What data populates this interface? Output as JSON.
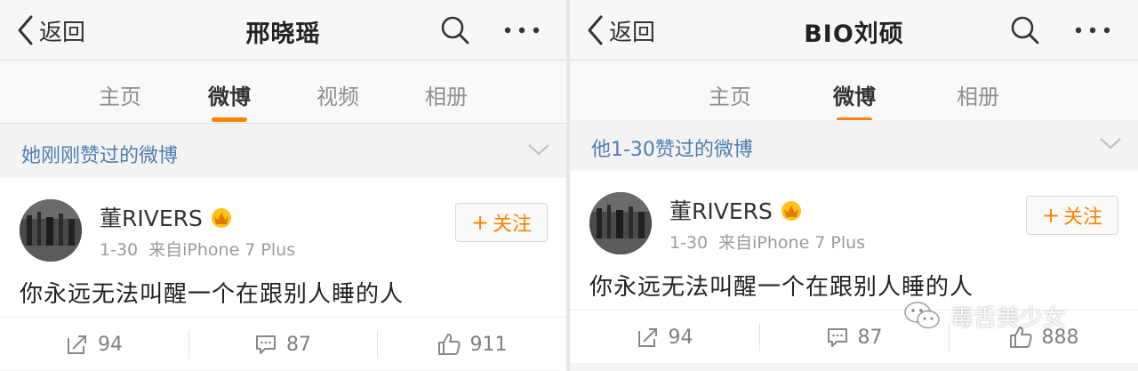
{
  "left": {
    "nav": {
      "back_label": "返回",
      "title": "邢晓瑶"
    },
    "tabs": [
      "主页",
      "微博",
      "视频",
      "相册"
    ],
    "active_tab": "微博",
    "liked_label": "她刚刚赞过的微博",
    "post": {
      "author": "董RIVERS",
      "date": "1-30",
      "source": "来自iPhone 7 Plus",
      "follow_label": "关注",
      "text": "你永远无法叫醒一个在跟别人睡的人",
      "reposts": "94",
      "comments": "87",
      "likes": "911"
    }
  },
  "right": {
    "nav": {
      "back_label": "返回",
      "title": "BIO刘硕"
    },
    "tabs": [
      "主页",
      "微博",
      "相册"
    ],
    "active_tab": "微博",
    "liked_label": "他1-30赞过的微博",
    "post": {
      "author": "董RIVERS",
      "date": "1-30",
      "source": "来自iPhone 7 Plus",
      "follow_label": "关注",
      "text": "你永远无法叫醒一个在跟别人睡的人",
      "reposts": "94",
      "comments": "87",
      "likes": "888"
    }
  },
  "watermark": "毒舌美少女",
  "colors": {
    "accent": "#ff8200",
    "link": "#507daf"
  },
  "icons": [
    "back-chevron-icon",
    "search-icon",
    "more-icon",
    "chevron-down-icon",
    "vip-crown-icon",
    "repost-icon",
    "comment-icon",
    "like-icon",
    "wechat-icon"
  ]
}
